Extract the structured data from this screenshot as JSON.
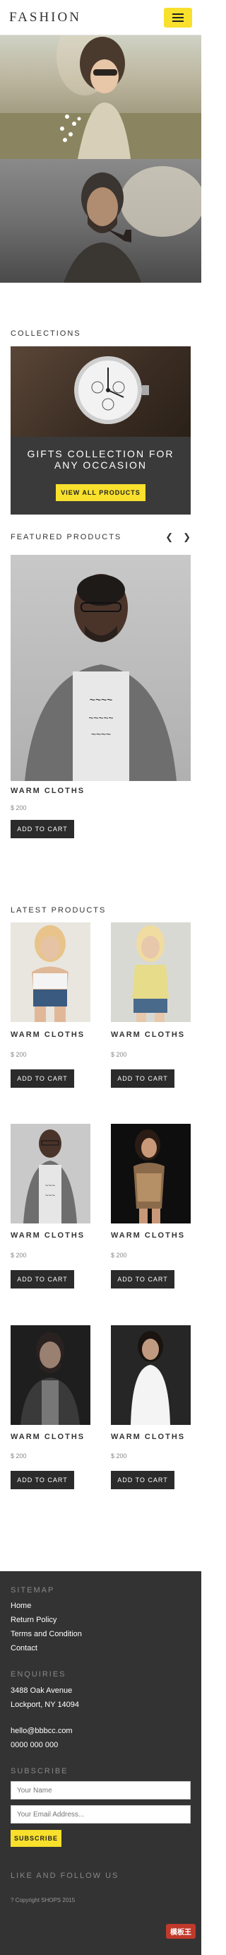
{
  "header": {
    "logo": "FASHION"
  },
  "sections": {
    "collections": "COLLECTIONS",
    "featured": "FEATURED PRODUCTS",
    "latest": "LATEST PRODUCTS"
  },
  "gift": {
    "title_line1": "GIFTS COLLECTION FOR",
    "title_line2": "ANY OCCASION",
    "button": "VIEW ALL PRODUCTS"
  },
  "featured": {
    "name": "WARM CLOTHS",
    "price": "$ 200",
    "button": "ADD TO CART"
  },
  "latest": [
    {
      "name": "WARM CLOTHS",
      "price": "$ 200",
      "button": "ADD TO CART"
    },
    {
      "name": "WARM CLOTHS",
      "price": "$ 200",
      "button": "ADD TO CART"
    },
    {
      "name": "WARM CLOTHS",
      "price": "$ 200",
      "button": "ADD TO CART"
    },
    {
      "name": "WARM CLOTHS",
      "price": "$ 200",
      "button": "ADD TO CART"
    },
    {
      "name": "WARM CLOTHS",
      "price": "$ 200",
      "button": "ADD TO CART"
    },
    {
      "name": "WARM CLOTHS",
      "price": "$ 200",
      "button": "ADD TO CART"
    }
  ],
  "footer": {
    "sitemap": "SITEMAP",
    "links": [
      "Home",
      "Return Policy",
      "Terms and Condition",
      "Contact"
    ],
    "enquiries": "ENQUIRIES",
    "address1": "3488 Oak Avenue",
    "address2": "Lockport, NY 14094",
    "email": "hello@bbbcc.com",
    "phone": "0000 000 000",
    "subscribe": "SUBSCRIBE",
    "name_placeholder": "Your Name",
    "email_placeholder": "Your Email Address...",
    "subscribe_button": "SUBSCRIBE",
    "like_follow": "LIKE AND FOLLOW US",
    "copyright": "? Copyright SHOPS 2015",
    "watermark": "模板王"
  },
  "colors": {
    "accent": "#f8e02c",
    "dark": "#2b2b2b",
    "footer_bg": "#333333"
  },
  "icons": {
    "menu": "hamburger-icon",
    "prev": "chevron-left-icon",
    "next": "chevron-right-icon"
  }
}
